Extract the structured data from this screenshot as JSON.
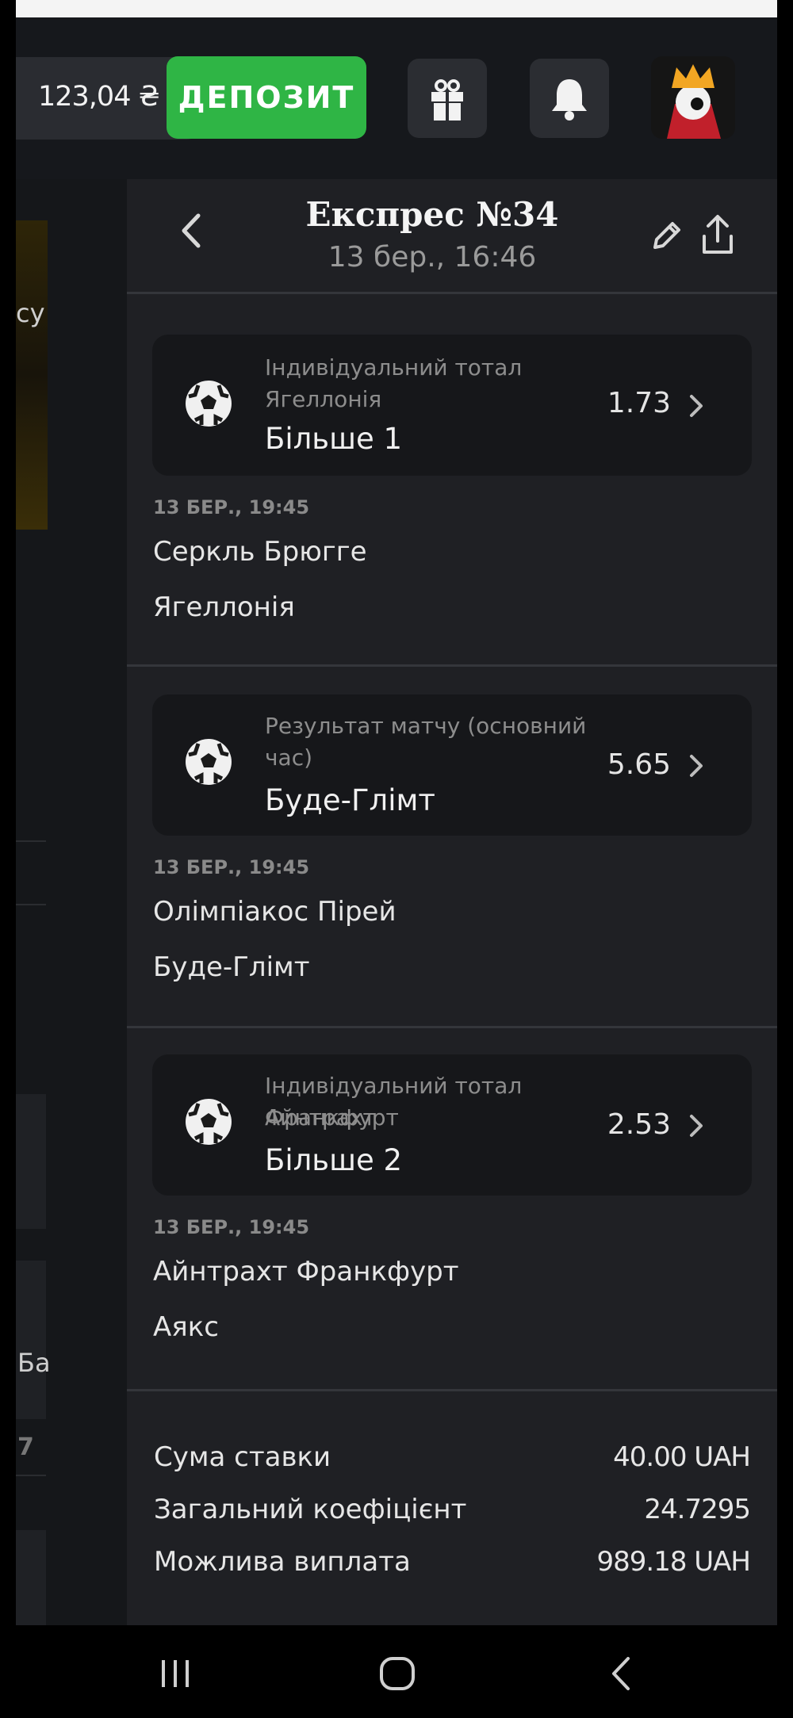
{
  "header": {
    "balance": "123,04 ₴",
    "deposit_label": "ДЕПОЗИТ"
  },
  "left_panel": {
    "fragment_1": "су",
    "fragment_2": "Ба",
    "fragment_3": "7"
  },
  "ticket": {
    "title": "Експрес №34",
    "datetime": "13 бер., 16:46"
  },
  "bets": [
    {
      "market": [
        "Індивідуальний тотал",
        "Ягеллонія"
      ],
      "selection": "Більше 1",
      "odds": "1.73",
      "date": "13 БЕР., 19:45",
      "home": "Серкль Брюгге",
      "away": "Ягеллонія"
    },
    {
      "market": [
        "Результат матчу (основний",
        "час)"
      ],
      "selection": "Буде-Глімт",
      "odds": "5.65",
      "date": "13 БЕР., 19:45",
      "home": "Олімпіакос Пірей",
      "away": "Буде-Глімт"
    },
    {
      "market": [
        "Індивідуальний тотал Айнтрахт",
        "Франкфурт"
      ],
      "selection": "Більше 2",
      "odds": "2.53",
      "date": "13 БЕР., 19:45",
      "home": "Айнтрахт Франкфурт",
      "away": "Аякс"
    }
  ],
  "summary": {
    "stake_label": "Сума ставки",
    "stake_value": "40.00 UAH",
    "total_odds_label": "Загальний коефіцієнт",
    "total_odds_value": "24.7295",
    "payout_label": "Можлива виплата",
    "payout_value": "989.18 UAH"
  },
  "icons": {
    "gift": "gift-icon",
    "bell": "bell-icon",
    "back": "chevron-left-icon",
    "edit": "pencil-icon",
    "share": "share-icon",
    "sport": "soccer-ball-icon"
  },
  "colors": {
    "deposit": "#2fb545",
    "background": "#1f2024",
    "card": "#16171a"
  }
}
